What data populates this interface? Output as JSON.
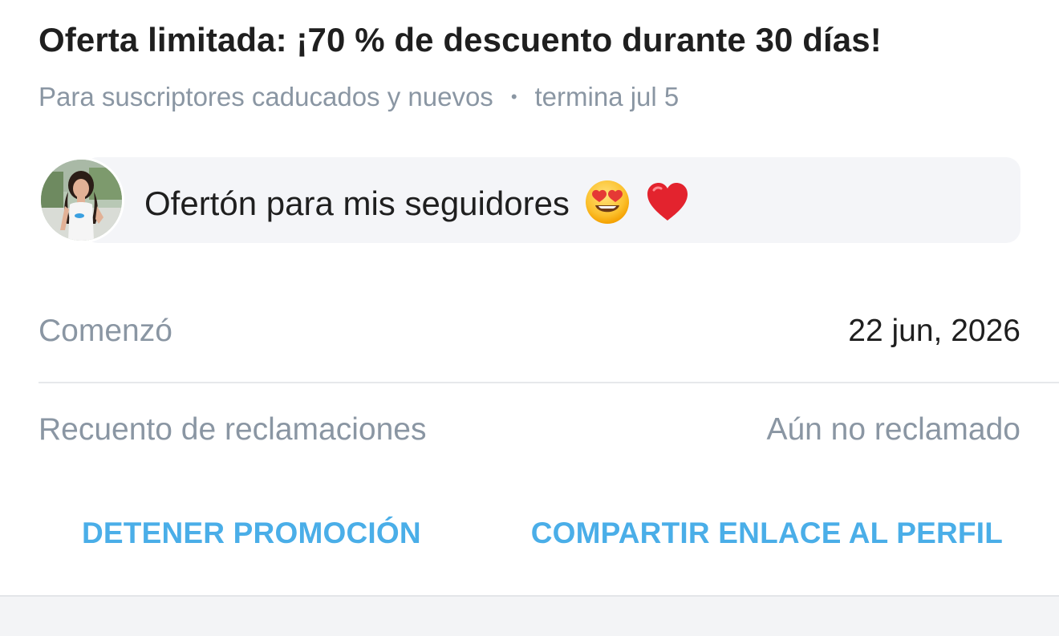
{
  "offer": {
    "title": "Oferta limitada: ¡70 % de descuento durante 30 días!",
    "audience": "Para suscriptores caducados y nuevos",
    "separator": "•",
    "ends": "termina jul 5"
  },
  "message": {
    "text": "Ofertón para mis seguidores",
    "emojis": [
      "heart-eyes-emoji",
      "red-heart-emoji"
    ],
    "avatar": "creator-avatar"
  },
  "details": {
    "started_label": "Comenzó",
    "started_value": "22 jun, 2026",
    "claims_label": "Recuento de reclamaciones",
    "claims_value": "Aún no reclamado"
  },
  "actions": {
    "stop_label": "DETENER PROMOCIÓN",
    "share_label": "COMPARTIR ENLACE AL PERFIL"
  },
  "colors": {
    "accent": "#4aaee8",
    "muted_text": "#8a96a3",
    "primary_text": "#1f1f1f",
    "bubble_bg": "#f4f5f8",
    "divider": "#e6e8eb"
  }
}
